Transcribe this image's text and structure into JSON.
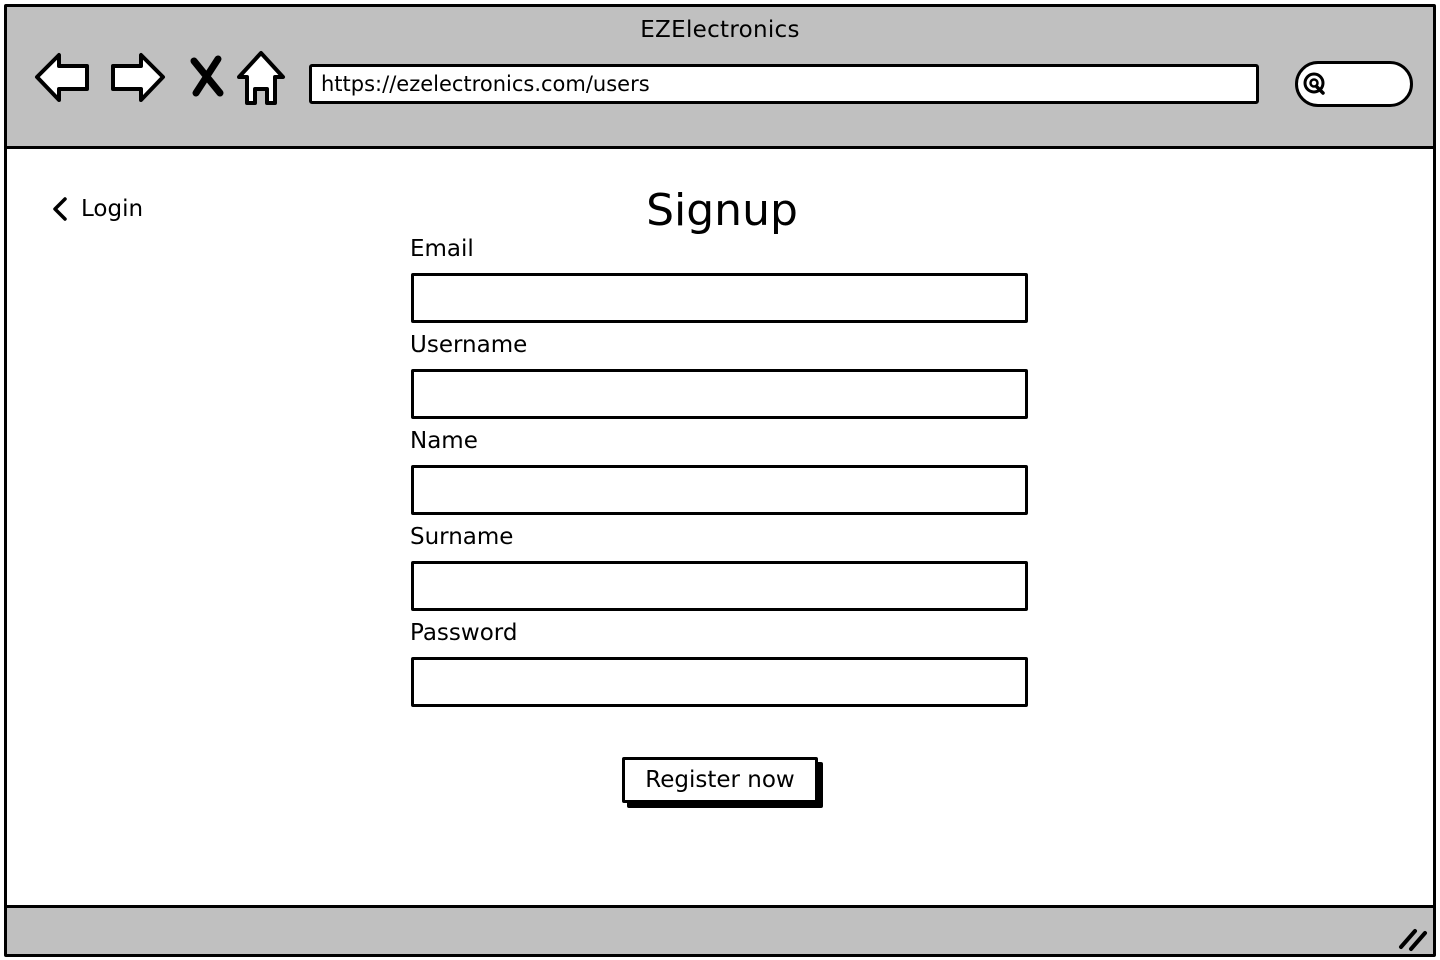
{
  "window": {
    "title": "EZElectronics"
  },
  "toolbar": {
    "back_icon": "back-arrow-icon",
    "forward_icon": "forward-arrow-icon",
    "stop_icon": "stop-x-icon",
    "home_icon": "home-icon",
    "url": "https://ezelectronics.com/users",
    "search_icon": "search-icon",
    "search_value": ""
  },
  "page": {
    "back_link_label": "Login",
    "back_link_icon": "chevron-left-icon",
    "title": "Signup",
    "fields": [
      {
        "label": "Email",
        "value": ""
      },
      {
        "label": "Username",
        "value": ""
      },
      {
        "label": "Name",
        "value": ""
      },
      {
        "label": "Surname",
        "value": ""
      },
      {
        "label": "Password",
        "value": ""
      }
    ],
    "submit_label": "Register now"
  },
  "statusbar": {
    "grip_icon": "resize-grip-icon"
  },
  "colors": {
    "chrome": "#c0c0c0",
    "ink": "#000000",
    "background": "#ffffff"
  }
}
